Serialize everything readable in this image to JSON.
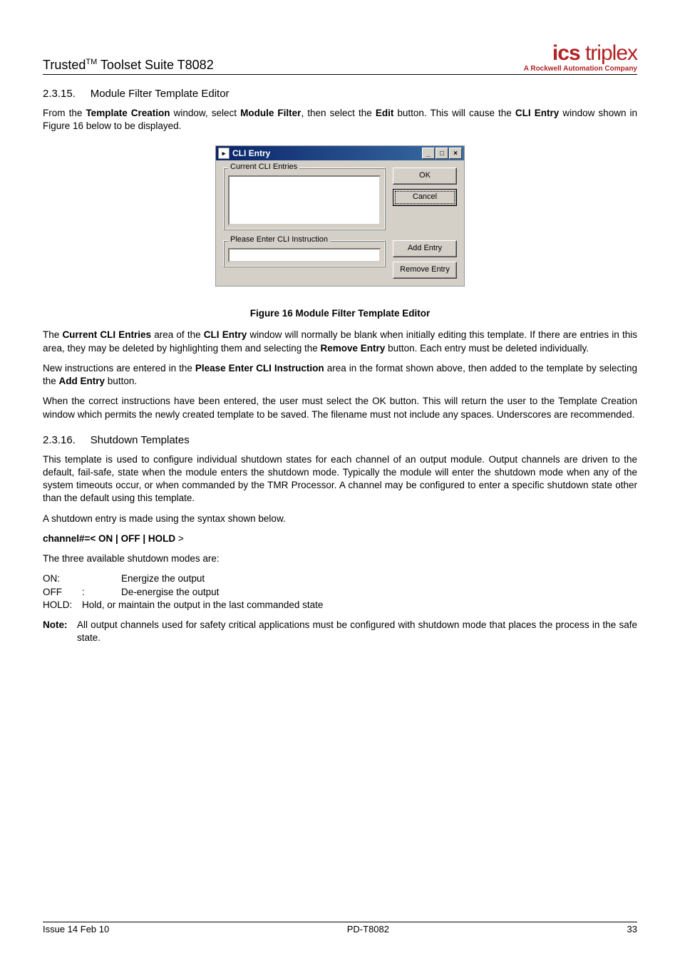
{
  "header": {
    "doc_title_prefix": "Trusted",
    "doc_title_tm": "TM",
    "doc_title_suffix": " Toolset Suite T8082",
    "logo_main_bold": "ics",
    "logo_main_thin": " triplex",
    "logo_sub": "A Rockwell Automation Company"
  },
  "s1": {
    "num": "2.3.15.",
    "title": "Module Filter Template Editor",
    "p1_a": "From the ",
    "p1_b": "Template Creation",
    "p1_c": " window, select ",
    "p1_d": "Module Filter",
    "p1_e": ", then select the ",
    "p1_f": "Edit",
    "p1_g": " button.  This will cause the ",
    "p1_h": "CLI Entry",
    "p1_i": " window shown in Figure 16 below to be displayed."
  },
  "dialog": {
    "title": "CLI Entry",
    "group1": "Current CLI Entries",
    "group2": "Please Enter CLI Instruction",
    "ok": "OK",
    "cancel": "Cancel",
    "add": "Add Entry",
    "remove": "Remove Entry"
  },
  "fig_caption": "Figure 16 Module Filter Template Editor",
  "p2_a": "The ",
  "p2_b": "Current CLI Entries",
  "p2_c": " area of the ",
  "p2_d": "CLI Entry",
  "p2_e": " window will normally be blank when initially editing this template.  If there are entries in this area, they may be deleted by highlighting them and selecting the ",
  "p2_f": "Remove Entry",
  "p2_g": " button.  Each entry must be deleted individually.",
  "p3_a": "New instructions are entered in the ",
  "p3_b": "Please Enter CLI Instruction",
  "p3_c": " area in the format shown above, then added to the template by selecting the ",
  "p3_d": "Add Entry",
  "p3_e": " button.",
  "p4": "When the correct instructions have been entered, the user must select the OK button.  This will return the user to the Template Creation window which permits the newly created template to be saved. The filename must not include any spaces. Underscores are recommended.",
  "s2": {
    "num": "2.3.16.",
    "title": "Shutdown Templates",
    "p1": "This template is used to configure individual shutdown states for each channel of an output module.  Output channels are driven to the default, fail-safe, state when the module enters the shutdown mode.  Typically the module will enter the shutdown mode when any of the system timeouts occur, or when commanded by the TMR Processor. A channel may be configured to enter a specific shutdown state other than the default using this template.",
    "p2": "A shutdown entry is made using the syntax shown below.",
    "syntax_bold": "channel#=< ON | OFF | HOLD",
    "syntax_rest": " >",
    "p3": "The three available shutdown modes are:",
    "modes": {
      "on_label": "ON:",
      "on_desc": "Energize the output",
      "off_label": "OFF",
      "off_colon": ":",
      "off_desc": "De-energise the output",
      "hold_label": "HOLD:",
      "hold_desc": "Hold, or maintain the output in the last commanded state"
    },
    "note_label": "Note:",
    "note_body": "All output channels used for safety critical applications must be configured with shutdown mode that places the process in the safe state."
  },
  "footer": {
    "left": "Issue 14 Feb 10",
    "center": "PD-T8082",
    "right": "33"
  }
}
